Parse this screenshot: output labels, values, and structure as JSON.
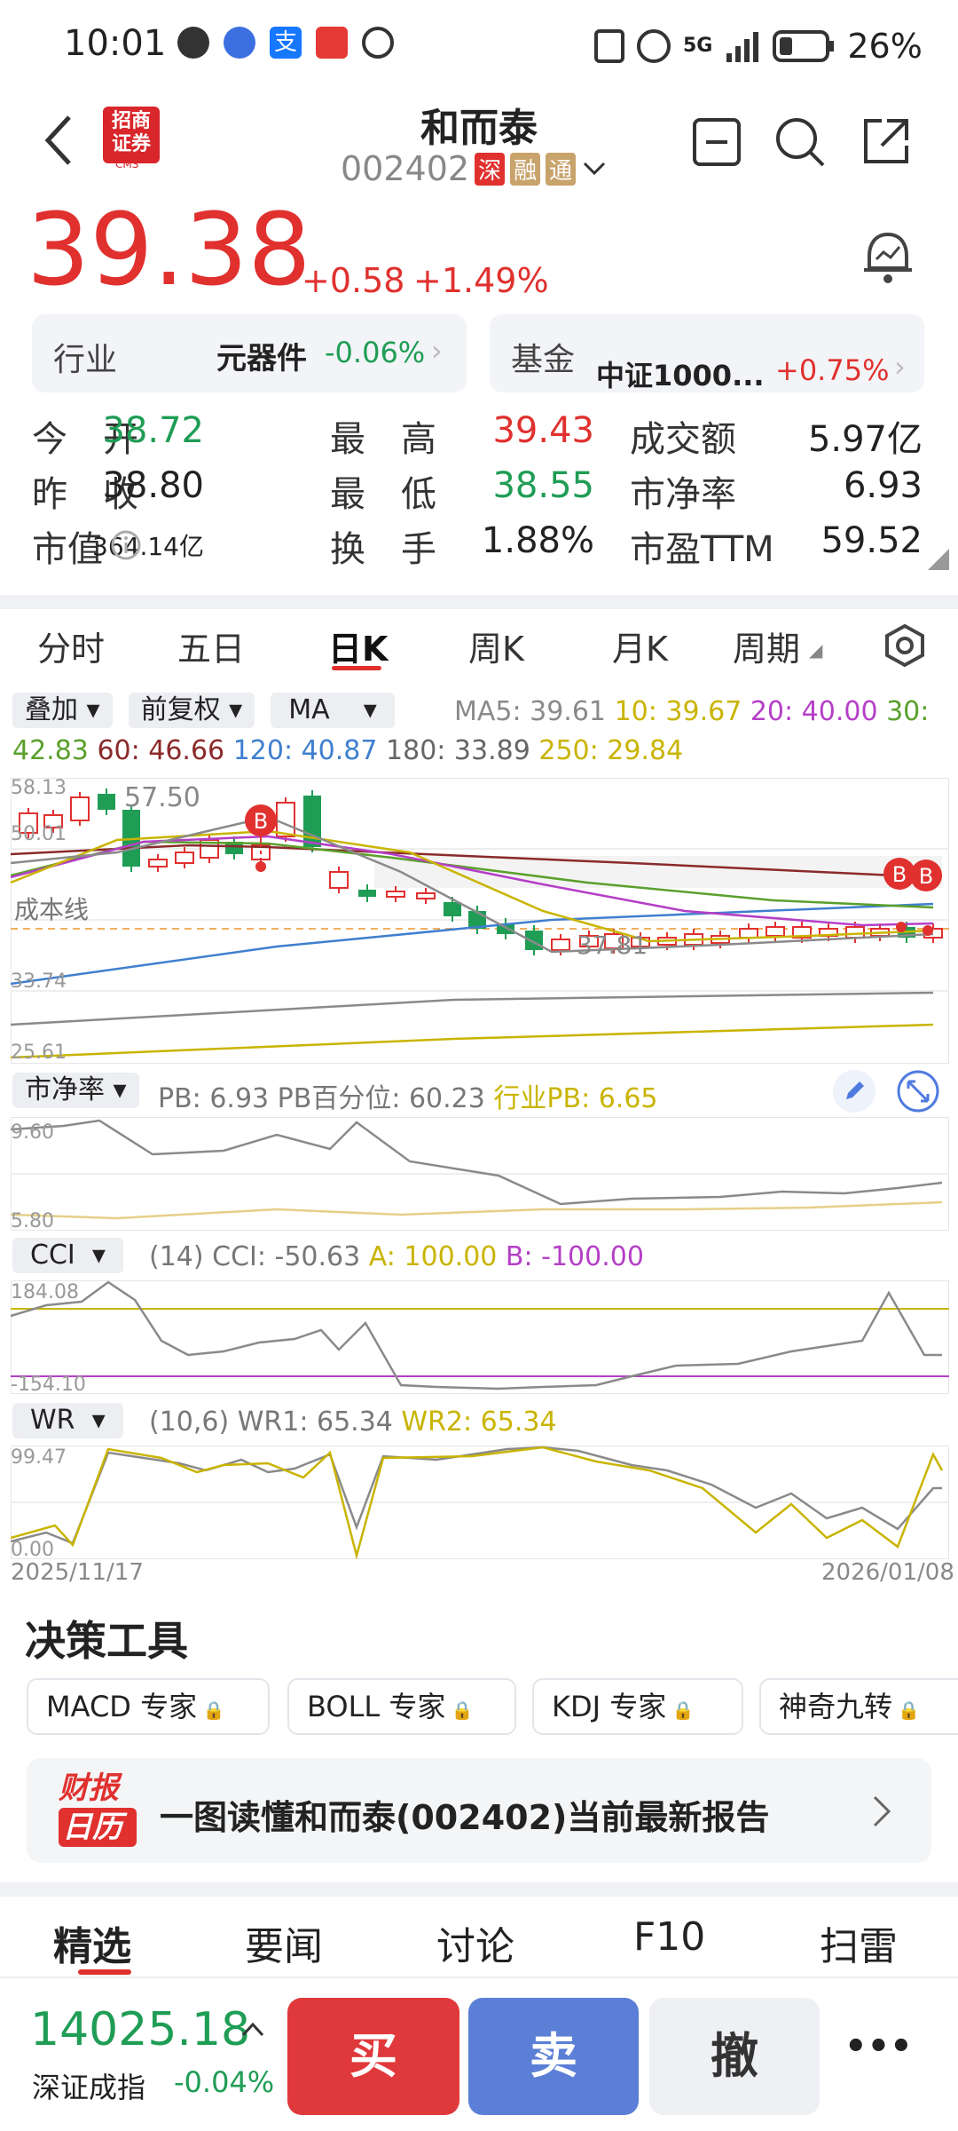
{
  "status_bar": {
    "time": "10:01",
    "battery": "26%",
    "signal": "5G"
  },
  "header": {
    "broker_logo": "招商证券",
    "broker_sub": "CMS",
    "stock_name": "和而泰",
    "stock_code": "002402",
    "tag_shen": "深",
    "tag_rong": "融",
    "tag_tong": "通"
  },
  "quote": {
    "price": "39.38",
    "change": "+0.58",
    "change_pct": "+1.49%"
  },
  "industry": {
    "label": "行业",
    "name": "元器件",
    "pct": "-0.06%"
  },
  "fund": {
    "label": "基金",
    "name": "中证1000...",
    "pct": "+0.75%"
  },
  "stats": [
    {
      "label": "今　开",
      "value": "38.72",
      "color": "green"
    },
    {
      "label": "最　高",
      "value": "39.43",
      "color": "red"
    },
    {
      "label": "成交额",
      "value": "5.97亿",
      "color": "black"
    },
    {
      "label": "昨　收",
      "value": "38.80",
      "color": "black"
    },
    {
      "label": "最　低",
      "value": "38.55",
      "color": "green"
    },
    {
      "label": "市净率",
      "value": "6.93",
      "color": "black"
    },
    {
      "label": "市值",
      "value": "364.14亿",
      "color": "black"
    },
    {
      "label": "换　手",
      "value": "1.88%",
      "color": "black"
    },
    {
      "label": "市盈TTM",
      "value": "59.52",
      "color": "black"
    }
  ],
  "chart_tabs": [
    "分时",
    "五日",
    "日K",
    "周K",
    "月K",
    "周期"
  ],
  "active_chart_tab": "日K",
  "overlay": {
    "overlay_label": "叠加",
    "adjust_label": "前复权",
    "ma_label": "MA"
  },
  "ma_values": {
    "ma5": "MA5: 39.61",
    "ma10": "10: 39.67",
    "ma20": "20: 40.00",
    "ma30": "30:",
    "ma30v": "42.83",
    "ma60": "60: 46.66",
    "ma120": "120: 40.87",
    "ma180": "180: 33.89",
    "ma250": "250: 29.84"
  },
  "kline": {
    "ymax": "58.13",
    "ymid": "50.01",
    "cost_line": "成本线",
    "ylow": "33.74",
    "ymin": "25.61",
    "hi_label": "57.50",
    "lo_label": "37.81",
    "marker": "B",
    "date_start": "2025/11/17",
    "date_end": "2026/01/08"
  },
  "pb": {
    "label": "市净率",
    "text": "PB: 6.93  PB百分位: 60.23",
    "industry": "行业PB: 6.65",
    "ymax": "9.60",
    "ymin": "5.80"
  },
  "cci": {
    "label": "CCI",
    "text": "(14) CCI: -50.63",
    "a": "A: 100.00",
    "b": "B: -100.00",
    "ymax": "184.08",
    "ymin": "-154.10"
  },
  "wr": {
    "label": "WR",
    "text": "(10,6) WR1: 65.34",
    "wr2": "WR2: 65.34",
    "ymax": "99.47",
    "ymin": "0.00"
  },
  "decision": {
    "title": "决策工具",
    "tools": [
      "MACD 专家",
      "BOLL 专家",
      "KDJ 专家",
      "神奇九转"
    ]
  },
  "report": {
    "logo_top": "财报",
    "logo_bottom": "日历",
    "text": "一图读懂和而泰(002402)当前最新报告"
  },
  "bottom_tabs": [
    "精选",
    "要闻",
    "讨论",
    "F10",
    "扫雷"
  ],
  "active_bottom_tab": "精选",
  "index": {
    "value": "14025.18",
    "name": "深证成指",
    "pct": "-0.04%"
  },
  "actions": {
    "buy": "买",
    "sell": "卖",
    "cancel": "撤",
    "more": "•••"
  },
  "colors": {
    "up": "#e0312f",
    "down": "#1f9d55",
    "buy": "#e0393c",
    "sell": "#5b7fd6",
    "ma5": "#8a8a8a",
    "ma10": "#c9b400",
    "ma20": "#b53fc7",
    "ma30": "#5aa02c",
    "ma60": "#8b2a2a",
    "ma120": "#3f7fcf"
  }
}
